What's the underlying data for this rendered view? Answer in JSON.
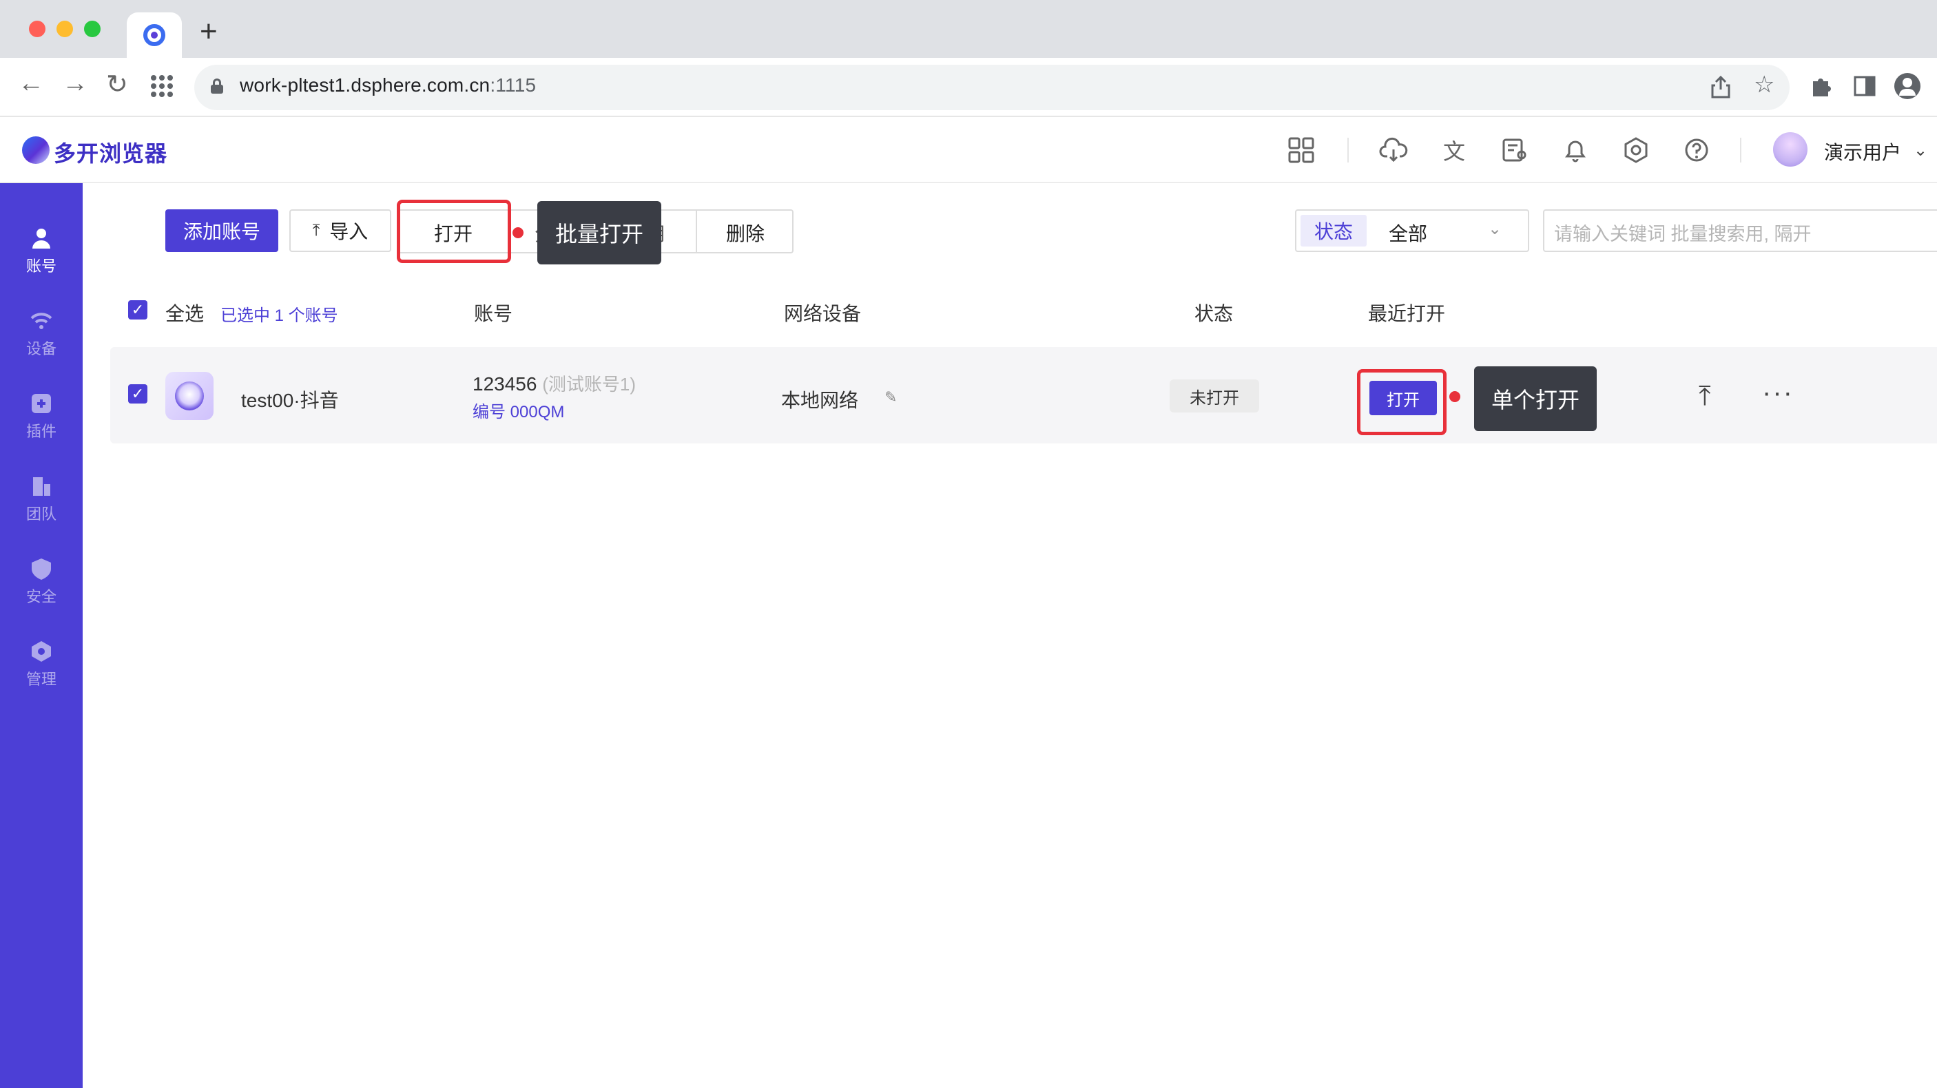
{
  "browser": {
    "traffic_lights": [
      "#ff5f57",
      "#febc2e",
      "#28c840"
    ],
    "new_tab": "+",
    "url_host": "work-pltest1.dsphere.com.cn",
    "url_port": ":1115"
  },
  "app": {
    "logo_text": "多开浏览器",
    "brand_color": "#4c3fd6",
    "user_name": "演示用户"
  },
  "sidebar": {
    "items": [
      {
        "label": "账号",
        "icon": "user-icon",
        "active": true
      },
      {
        "label": "设备",
        "icon": "wifi-icon",
        "active": false
      },
      {
        "label": "插件",
        "icon": "plugin-icon",
        "active": false
      },
      {
        "label": "团队",
        "icon": "building-icon",
        "active": false
      },
      {
        "label": "安全",
        "icon": "shield-icon",
        "active": false
      },
      {
        "label": "管理",
        "icon": "hexagon-icon",
        "active": false
      }
    ]
  },
  "toolbar": {
    "add_account": "添加账号",
    "import": "导入",
    "open": "打开",
    "group_hidden_left": "分",
    "group_hidden_right": "用",
    "delete": "删除",
    "batch_open_tip": "批量打开",
    "status_label": "状态",
    "status_value": "全部",
    "search_placeholder": "请输入关键词 批量搜索用, 隔开"
  },
  "table": {
    "select_all": "全选",
    "selected_info": "已选中 1 个账号",
    "columns": [
      "账号",
      "网络设备",
      "状态",
      "最近打开"
    ],
    "rows": [
      {
        "name": "test00·抖音",
        "account": "123456",
        "account_note": "(测试账号1)",
        "account_id": "编号 000QM",
        "network": "本地网络",
        "status": "未打开",
        "open_label": "打开",
        "single_open_tip": "单个打开"
      }
    ]
  }
}
